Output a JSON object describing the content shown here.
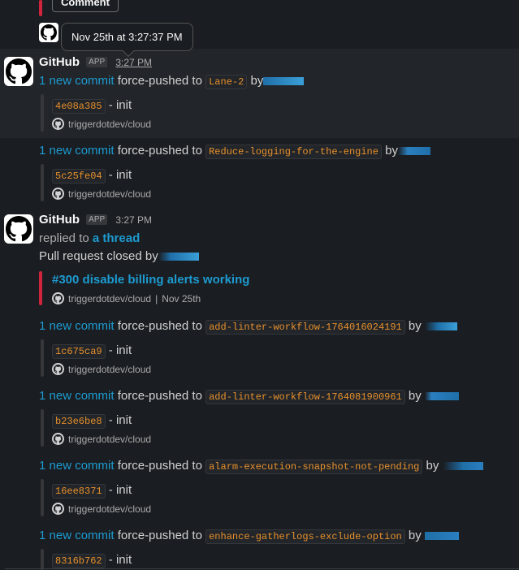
{
  "top": {
    "comment_button": "Comment",
    "tooltip": "Nov 25th at 3:27:37 PM"
  },
  "msg1": {
    "sender": "GitHub",
    "badge": "APP",
    "time": "3:27 PM",
    "line": {
      "commit_link": "1 new commit",
      "action": "force-pushed to",
      "branch": "Lane-2",
      "by": "by"
    },
    "commit": {
      "hash": "4e08a385",
      "msg": "- init",
      "repo": "triggerdotdev/cloud"
    }
  },
  "msg2": {
    "line": {
      "commit_link": "1 new commit",
      "action": "force-pushed to",
      "branch": "Reduce-logging-for-the-engine",
      "by": "by"
    },
    "commit": {
      "hash": "5c25fe04",
      "msg": "- init",
      "repo": "triggerdotdev/cloud"
    }
  },
  "msg3": {
    "sender": "GitHub",
    "badge": "APP",
    "time": "3:27 PM",
    "replied_to": "replied to",
    "thread_link": "a thread",
    "pr_closed": "Pull request closed by",
    "pr": {
      "title": "#300 disable billing alerts working",
      "repo": "triggerdotdev/cloud",
      "date": "Nov 25th"
    }
  },
  "pushes": [
    {
      "commit_link": "1 new commit",
      "action": "force-pushed to",
      "branch": "add-linter-workflow-1764016024191",
      "by": "by",
      "hash": "1c675ca9",
      "msg": "- init",
      "repo": "triggerdotdev/cloud"
    },
    {
      "commit_link": "1 new commit",
      "action": "force-pushed to",
      "branch": "add-linter-workflow-1764081900961",
      "by": "by",
      "hash": "b23e6be8",
      "msg": "- init",
      "repo": "triggerdotdev/cloud"
    },
    {
      "commit_link": "1 new commit",
      "action": "force-pushed to",
      "branch": "alarm-execution-snapshot-not-pending",
      "by": "by",
      "hash": "16ee8371",
      "msg": "- init",
      "repo": "triggerdotdev/cloud"
    },
    {
      "commit_link": "1 new commit",
      "action": "force-pushed to",
      "branch": "enhance-gatherlogs-exclude-option",
      "by": "by",
      "hash": "8316b762",
      "msg": "- init"
    }
  ],
  "colors": {
    "background": "#1a1d21",
    "link": "#1d9bd1",
    "code": "#e8912d",
    "attachment_red": "#d0253c",
    "redaction": "#1f6fa8"
  }
}
